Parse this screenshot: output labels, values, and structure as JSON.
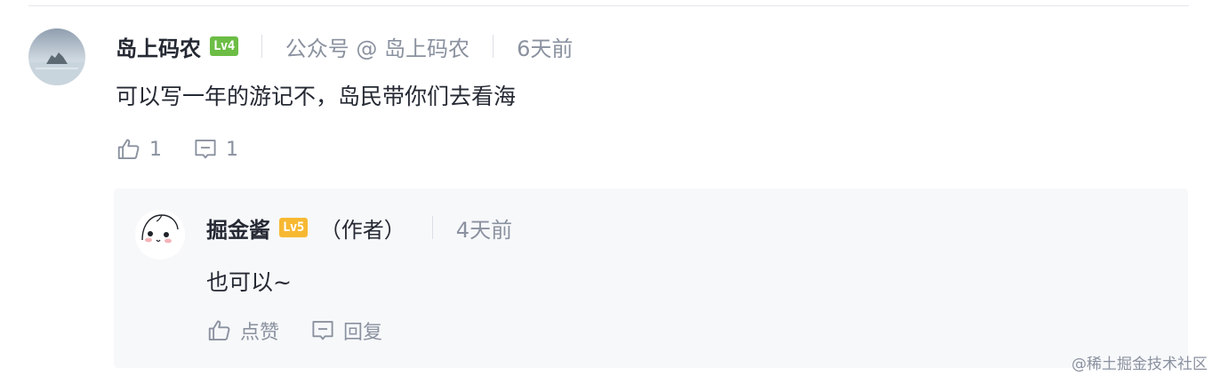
{
  "comment": {
    "username": "岛上码农",
    "level": "Lv4",
    "level_color": "#6cbd45",
    "source": "公众号 @ 岛上码农",
    "time": "6天前",
    "text": "可以写一年的游记不，岛民带你们去看海",
    "like_count": "1",
    "reply_count": "1"
  },
  "reply": {
    "username": "掘金酱",
    "level": "Lv5",
    "level_color": "#f7b832",
    "author_tag": "（作者）",
    "time": "4天前",
    "text": "也可以~",
    "like_label": "点赞",
    "reply_label": "回复"
  },
  "watermark": "@稀土掘金技术社区",
  "colors": {
    "text_primary": "#252933",
    "text_secondary": "#8a919f",
    "reply_background": "#f7f8fa"
  },
  "icons": {
    "like": "thumbs-up-icon",
    "comment": "comment-bubble-icon"
  }
}
